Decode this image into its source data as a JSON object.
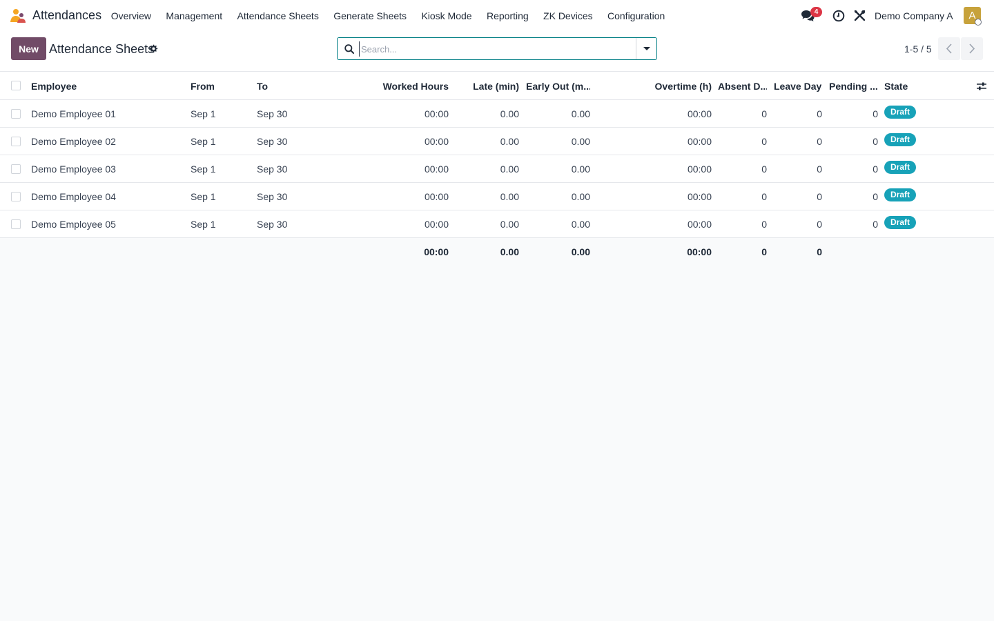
{
  "app": {
    "name": "Attendances",
    "logo_icon": "attendances-app-icon"
  },
  "menu": [
    {
      "label": "Overview"
    },
    {
      "label": "Management"
    },
    {
      "label": "Attendance Sheets"
    },
    {
      "label": "Generate Sheets"
    },
    {
      "label": "Kiosk Mode"
    },
    {
      "label": "Reporting"
    },
    {
      "label": "ZK Devices"
    },
    {
      "label": "Configuration"
    }
  ],
  "systray": {
    "messages_badge": "4",
    "company": "Demo Company A",
    "avatar_letter": "A",
    "avatar_color": "#c7a23b"
  },
  "control_panel": {
    "new_button": "New",
    "title": "Attendance Sheets",
    "search_placeholder": "Search...",
    "pager": "1-5 / 5",
    "primary_color": "#714b67"
  },
  "table": {
    "columns": {
      "employee": "Employee",
      "from": "From",
      "to": "To",
      "worked_hours": "Worked Hours",
      "late": "Late (min)",
      "early_out": "Early Out (m...",
      "overtime": "Overtime (h)",
      "absent": "Absent D...",
      "leave": "Leave Days",
      "pending": "Pending ...",
      "state": "State"
    },
    "rows": [
      {
        "employee": "Demo Employee 01",
        "from": "Sep 1",
        "to": "Sep 30",
        "worked_hours": "00:00",
        "late": "0.00",
        "early_out": "0.00",
        "overtime": "00:00",
        "absent": "0",
        "leave": "0",
        "pending": "0",
        "state": "Draft"
      },
      {
        "employee": "Demo Employee 02",
        "from": "Sep 1",
        "to": "Sep 30",
        "worked_hours": "00:00",
        "late": "0.00",
        "early_out": "0.00",
        "overtime": "00:00",
        "absent": "0",
        "leave": "0",
        "pending": "0",
        "state": "Draft"
      },
      {
        "employee": "Demo Employee 03",
        "from": "Sep 1",
        "to": "Sep 30",
        "worked_hours": "00:00",
        "late": "0.00",
        "early_out": "0.00",
        "overtime": "00:00",
        "absent": "0",
        "leave": "0",
        "pending": "0",
        "state": "Draft"
      },
      {
        "employee": "Demo Employee 04",
        "from": "Sep 1",
        "to": "Sep 30",
        "worked_hours": "00:00",
        "late": "0.00",
        "early_out": "0.00",
        "overtime": "00:00",
        "absent": "0",
        "leave": "0",
        "pending": "0",
        "state": "Draft"
      },
      {
        "employee": "Demo Employee 05",
        "from": "Sep 1",
        "to": "Sep 30",
        "worked_hours": "00:00",
        "late": "0.00",
        "early_out": "0.00",
        "overtime": "00:00",
        "absent": "0",
        "leave": "0",
        "pending": "0",
        "state": "Draft"
      }
    ],
    "totals": {
      "worked_hours": "00:00",
      "late": "0.00",
      "early_out": "0.00",
      "overtime": "00:00",
      "absent": "0",
      "leave": "0"
    },
    "state_badge_color": "#17a2b8"
  }
}
